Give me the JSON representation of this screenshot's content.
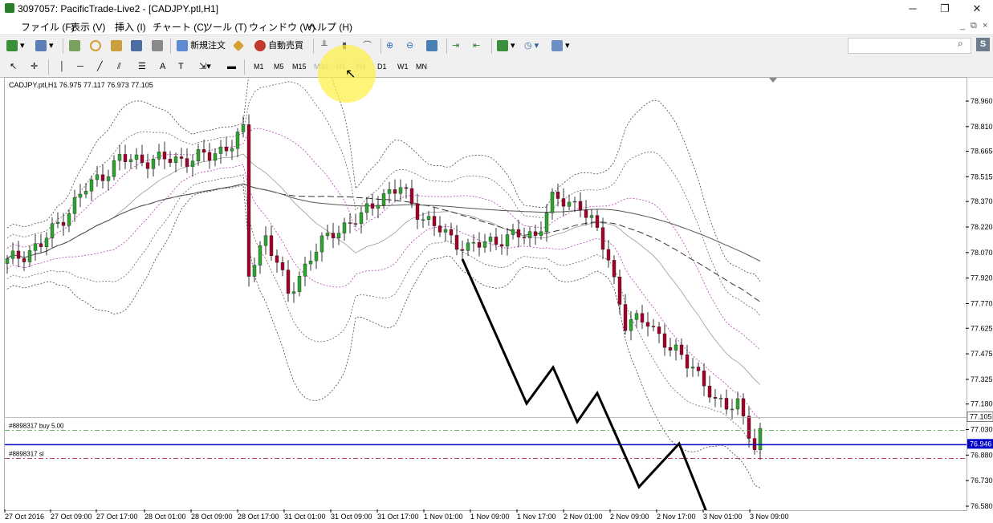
{
  "window": {
    "title": "3097057: PacificTrade-Live2 - [CADJPY.ptl,H1]",
    "controls": [
      "─",
      "❐",
      "✕"
    ],
    "mdi_controls": [
      "_",
      "⧉",
      "×"
    ]
  },
  "menu": [
    "ファイル (F)",
    "表示 (V)",
    "挿入 (I)",
    "チャート (C)",
    "ツール (T)",
    "ウィンドウ (W)",
    "ヘルプ (H)"
  ],
  "toolbar": {
    "new_order": "新規注文",
    "auto_trading": "自動売買",
    "search_placeholder": "",
    "badge": "S"
  },
  "timeframes": [
    "M1",
    "M5",
    "M15",
    "M30",
    "H1",
    "H4",
    "D1",
    "W1",
    "MN"
  ],
  "chart": {
    "symbol_header": "CADJPY.ptl,H1  76.975 77.117 76.973 77.105",
    "price_labels": [
      "78.960",
      "78.810",
      "78.665",
      "78.515",
      "78.370",
      "78.220",
      "78.070",
      "77.920",
      "77.770",
      "77.625",
      "77.475",
      "77.325",
      "77.180",
      "77.030",
      "76.880",
      "76.730",
      "76.580"
    ],
    "current_price": "77.105",
    "order_price": "76.946",
    "order_buy_label": "#8898317 buy 5.00",
    "order_sl_label": "#8898317 sl",
    "time_labels": [
      "27 Oct 2016",
      "27 Oct 09:00",
      "27 Oct 17:00",
      "28 Oct 01:00",
      "28 Oct 09:00",
      "28 Oct 17:00",
      "31 Oct 01:00",
      "31 Oct 09:00",
      "31 Oct 17:00",
      "1 Nov 01:00",
      "1 Nov 09:00",
      "1 Nov 17:00",
      "2 Nov 01:00",
      "2 Nov 09:00",
      "2 Nov 17:00",
      "3 Nov 01:00",
      "3 Nov 09:00"
    ],
    "colors": {
      "bull": "#2ea52e",
      "bear": "#a3002a",
      "band": "#555555",
      "band_inner": "#b040b0",
      "order_line": "#0000c8"
    }
  }
}
